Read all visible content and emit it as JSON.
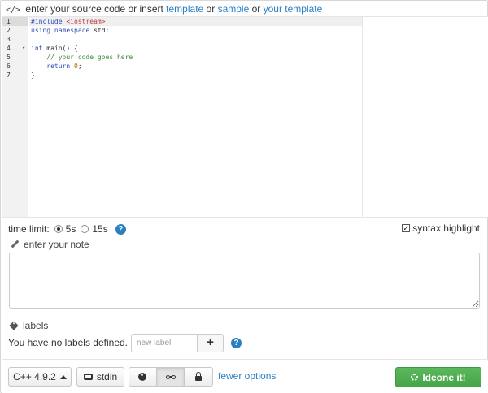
{
  "header": {
    "icon": "code-icon",
    "icon_text": "</>",
    "prefix": "enter your source code or insert",
    "template_link": "template",
    "or1": "or",
    "sample_link": "sample",
    "or2": "or",
    "your_template_link": "your template"
  },
  "editor": {
    "line_numbers": [
      "1",
      "2",
      "3",
      "4",
      "5",
      "6",
      "7"
    ],
    "active_line": 1,
    "fold_marker_line": 4
  },
  "options": {
    "time_limit_label": "time limit:",
    "option_5s": "5s",
    "option_15s": "15s",
    "selected": "5s",
    "help": "?",
    "syntax_highlight_label": "syntax highlight",
    "syntax_highlight_checked": true
  },
  "note": {
    "label": "enter your note",
    "value": ""
  },
  "labels": {
    "title": "labels",
    "none_text": "You have no labels defined.",
    "input_placeholder": "new label",
    "add_symbol": "+",
    "help": "?"
  },
  "footer": {
    "language": "C++ 4.9.2",
    "stdin_label": "stdin",
    "visibility_options": [
      "globe-icon",
      "glasses-icon",
      "lock-icon"
    ],
    "visibility_selected": "glasses-icon",
    "fewer_options_link": "fewer options",
    "run_label": "Ideone it!"
  },
  "colors": {
    "link": "#2a7fc1",
    "run_button": "#5cb85c",
    "keyword": "#2f4fb8",
    "string": "#c23b3b",
    "comment": "#3a8a3a"
  },
  "code": {
    "l1_directive": "#include",
    "l1_header": "<iostream>",
    "l2_using": "using",
    "l2_namespace": "namespace",
    "l2_std": "std;",
    "l4_int": "int",
    "l4_main": "main() {",
    "l5_comment": "// your code goes here",
    "l6_return": "return",
    "l6_zero": "0",
    "l6_semicolon": ";",
    "l7_close": "}"
  }
}
